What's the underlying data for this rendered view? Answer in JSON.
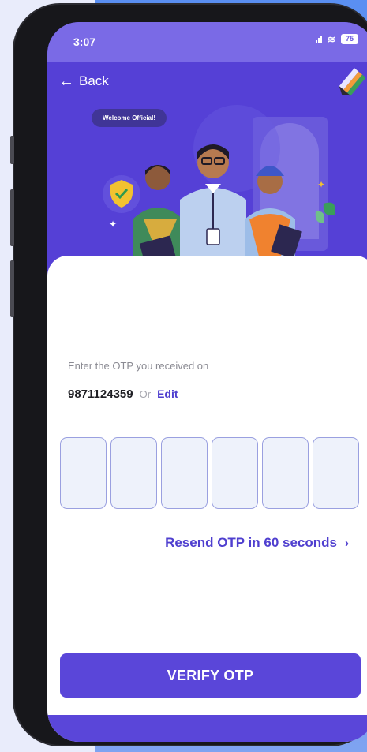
{
  "status_bar": {
    "time": "3:07",
    "battery": "75",
    "icons": [
      "signal-icon",
      "wifi-icon",
      "battery-icon"
    ]
  },
  "header": {
    "back_label": "Back",
    "back_icon": "arrow-left-icon",
    "logo_icon": "ballot-pencil-icon"
  },
  "hero": {
    "welcome_text": "Welcome Official!"
  },
  "otp_form": {
    "prompt": "Enter the OTP you received on",
    "phone_number": "9871124359",
    "or_text": "Or",
    "edit_label": "Edit",
    "digit_count": 6,
    "resend_label": "Resend OTP in 60 seconds",
    "verify_label": "VERIFY OTP"
  },
  "colors": {
    "primary": "#5a46d9",
    "header_bg": "#5540d6",
    "link": "#4f3fcf",
    "otp_box_border": "#9aa0e0",
    "otp_box_fill": "#eef2fb"
  }
}
